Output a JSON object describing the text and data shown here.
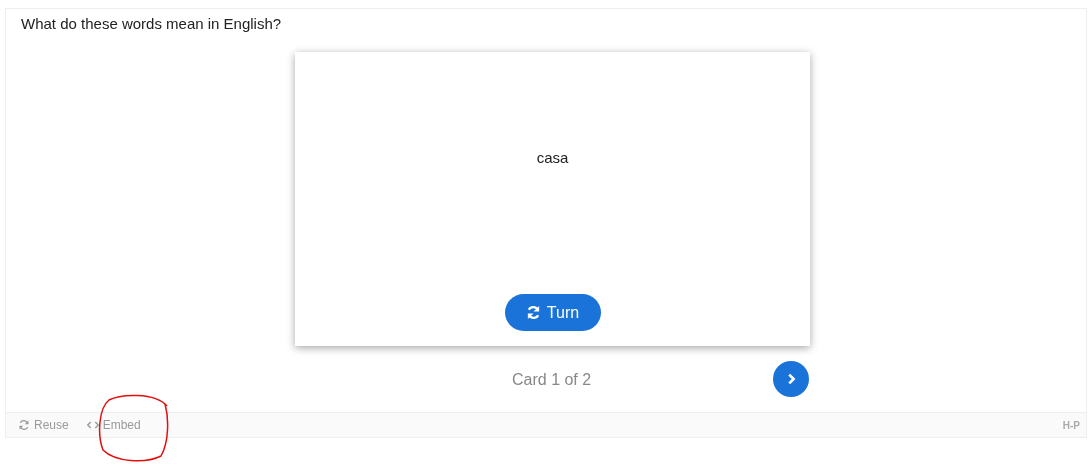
{
  "question": "What do these words mean in English?",
  "card": {
    "word": "casa",
    "turn_button": "Turn"
  },
  "progress": "Card 1 of 2",
  "footer": {
    "actions": [
      {
        "kind": "reuse",
        "label": "Reuse"
      },
      {
        "kind": "embed",
        "label": "Embed"
      }
    ],
    "logo": "H-P"
  }
}
